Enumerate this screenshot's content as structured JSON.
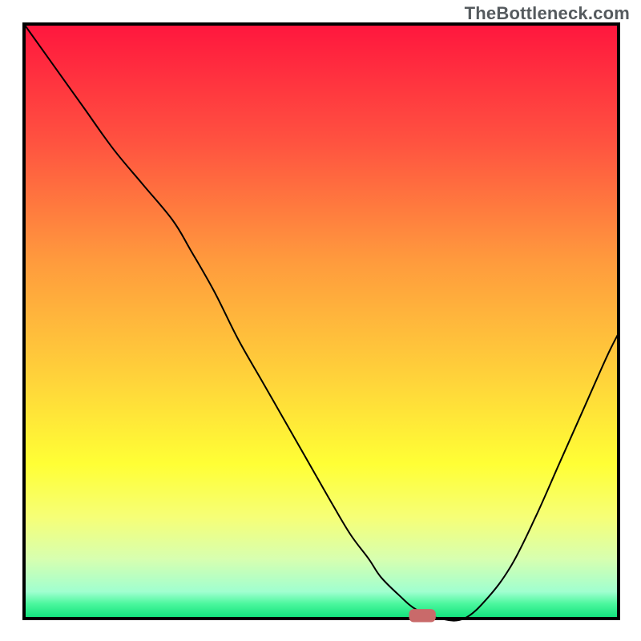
{
  "watermark": "TheBottleneck.com",
  "chart_data": {
    "type": "line",
    "title": "",
    "xlabel": "",
    "ylabel": "",
    "xlim": [
      0,
      100
    ],
    "ylim": [
      0,
      100
    ],
    "grid": false,
    "legend": false,
    "axes_visible": false,
    "background": {
      "type": "vertical-gradient",
      "stops": [
        {
          "offset": 0.0,
          "color": "#ff163e"
        },
        {
          "offset": 0.2,
          "color": "#ff5340"
        },
        {
          "offset": 0.4,
          "color": "#ff9b3d"
        },
        {
          "offset": 0.6,
          "color": "#ffd43a"
        },
        {
          "offset": 0.74,
          "color": "#ffff35"
        },
        {
          "offset": 0.83,
          "color": "#f6ff77"
        },
        {
          "offset": 0.9,
          "color": "#d7ffb0"
        },
        {
          "offset": 0.955,
          "color": "#a0ffd0"
        },
        {
          "offset": 0.975,
          "color": "#4cf79e"
        },
        {
          "offset": 1.0,
          "color": "#0de17a"
        }
      ]
    },
    "series": [
      {
        "name": "bottleneck-curve",
        "stroke": "#000000",
        "stroke_width": 2,
        "x": [
          0,
          5,
          10,
          15,
          20,
          25,
          28,
          32,
          36,
          40,
          44,
          48,
          52,
          55,
          58,
          60,
          63,
          66,
          70,
          74,
          78,
          82,
          86,
          90,
          94,
          98,
          100
        ],
        "y": [
          100,
          93,
          86,
          79,
          73,
          67,
          62,
          55,
          47,
          40,
          33,
          26,
          19,
          14,
          10,
          7,
          4,
          1.5,
          0,
          0,
          3.5,
          9,
          17,
          26,
          35,
          44,
          48
        ]
      }
    ],
    "marker": {
      "name": "optimal-point",
      "shape": "rounded-rect",
      "x": 67,
      "y": 0.5,
      "width": 4.5,
      "height": 2.2,
      "fill": "#c96a6a"
    }
  }
}
